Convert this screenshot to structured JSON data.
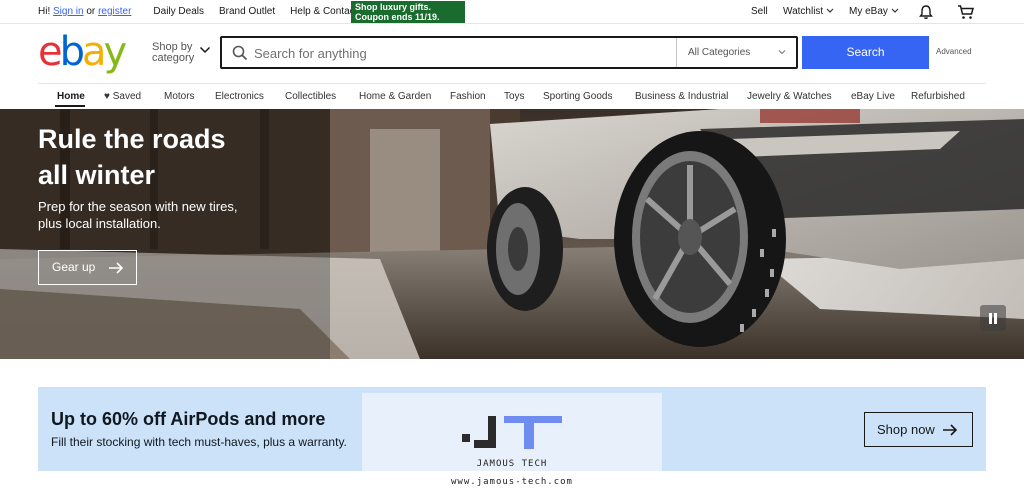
{
  "topbar": {
    "greeting": "Hi!",
    "sign_in": "Sign in",
    "or": "or",
    "register": "register",
    "links": [
      "Daily Deals",
      "Brand Outlet",
      "Help & Contact"
    ],
    "promo_line1": "Shop luxury gifts.",
    "promo_line2": "Coupon ends 11/19.",
    "sell": "Sell",
    "watchlist": "Watchlist",
    "my_ebay": "My eBay"
  },
  "header": {
    "logo_letters": [
      "e",
      "b",
      "a",
      "y"
    ],
    "shop_by_line1": "Shop by",
    "shop_by_line2": "category",
    "search_placeholder": "Search for anything",
    "category_select": "All Categories",
    "search_button": "Search",
    "advanced": "Advanced"
  },
  "nav": {
    "items": [
      "Home",
      "♥ Saved",
      "Motors",
      "Electronics",
      "Collectibles",
      "Home & Garden",
      "Fashion",
      "Toys",
      "Sporting Goods",
      "Business & Industrial",
      "Jewelry & Watches",
      "eBay Live",
      "Refurbished"
    ],
    "active": "Home"
  },
  "hero": {
    "title_line1": "Rule the roads",
    "title_line2": "all winter",
    "subtitle_line1": "Prep for the season with new tires,",
    "subtitle_line2": "plus local installation.",
    "button": "Gear up"
  },
  "banner": {
    "title": "Up to 60% off AirPods and more",
    "subtitle": "Fill their stocking with tech must-haves, plus a warranty.",
    "button": "Shop now",
    "background": "#cbe2f9"
  },
  "watermark": {
    "name": "JAMOUS TECH",
    "url": "www.jamous-tech.com"
  },
  "colors": {
    "accent": "#3665f3",
    "logo_e": "#e53238",
    "logo_b": "#0064d2",
    "logo_a": "#f5af02",
    "logo_y": "#86b817",
    "promo_bg": "#1a6b2e"
  },
  "icons": [
    "chevron-down-icon",
    "bell-icon",
    "cart-icon",
    "search-icon",
    "heart-icon",
    "arrow-right-icon",
    "pause-icon"
  ]
}
